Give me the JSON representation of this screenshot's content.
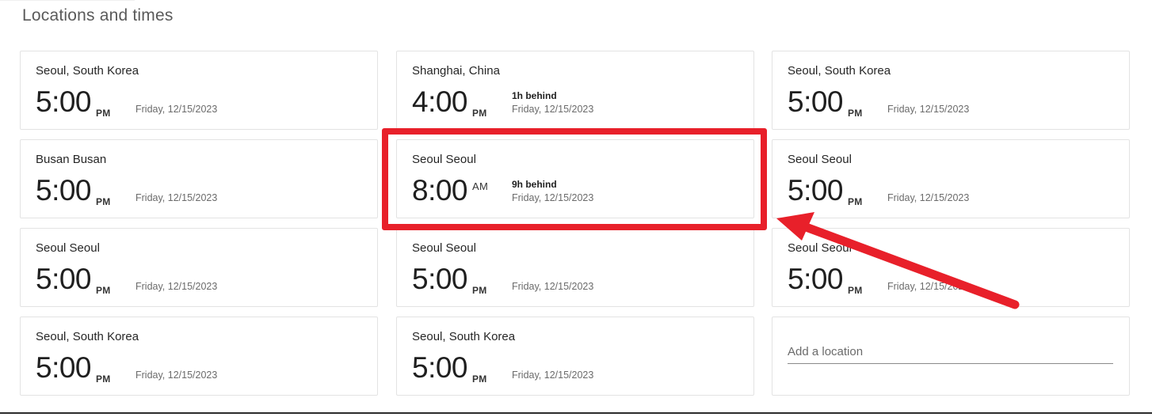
{
  "page": {
    "title": "Locations and times"
  },
  "cards": [
    {
      "name": "Seoul, South Korea",
      "time": "5:00",
      "ampm": "PM",
      "date": "Friday, 12/15/2023",
      "offset": ""
    },
    {
      "name": "Shanghai, China",
      "time": "4:00",
      "ampm": "PM",
      "date": "Friday, 12/15/2023",
      "offset": "1h behind"
    },
    {
      "name": "Seoul, South Korea",
      "time": "5:00",
      "ampm": "PM",
      "date": "Friday, 12/15/2023",
      "offset": ""
    },
    {
      "name": "Busan Busan",
      "time": "5:00",
      "ampm": "PM",
      "date": "Friday, 12/15/2023",
      "offset": ""
    },
    {
      "name": "Seoul Seoul",
      "time": "8:00",
      "ampm": "AM",
      "date": "Friday, 12/15/2023",
      "offset": "9h behind"
    },
    {
      "name": "Seoul Seoul",
      "time": "5:00",
      "ampm": "PM",
      "date": "Friday, 12/15/2023",
      "offset": ""
    },
    {
      "name": "Seoul Seoul",
      "time": "5:00",
      "ampm": "PM",
      "date": "Friday, 12/15/2023",
      "offset": ""
    },
    {
      "name": "Seoul Seoul",
      "time": "5:00",
      "ampm": "PM",
      "date": "Friday, 12/15/2023",
      "offset": ""
    },
    {
      "name": "Seoul Seoul",
      "time": "5:00",
      "ampm": "PM",
      "date": "Friday, 12/15/2023",
      "offset": ""
    },
    {
      "name": "Seoul, South Korea",
      "time": "5:00",
      "ampm": "PM",
      "date": "Friday, 12/15/2023",
      "offset": ""
    },
    {
      "name": "Seoul, South Korea",
      "time": "5:00",
      "ampm": "PM",
      "date": "Friday, 12/15/2023",
      "offset": ""
    }
  ],
  "add_location": {
    "placeholder": "Add a location"
  },
  "annotation": {
    "color": "#e8202a"
  }
}
